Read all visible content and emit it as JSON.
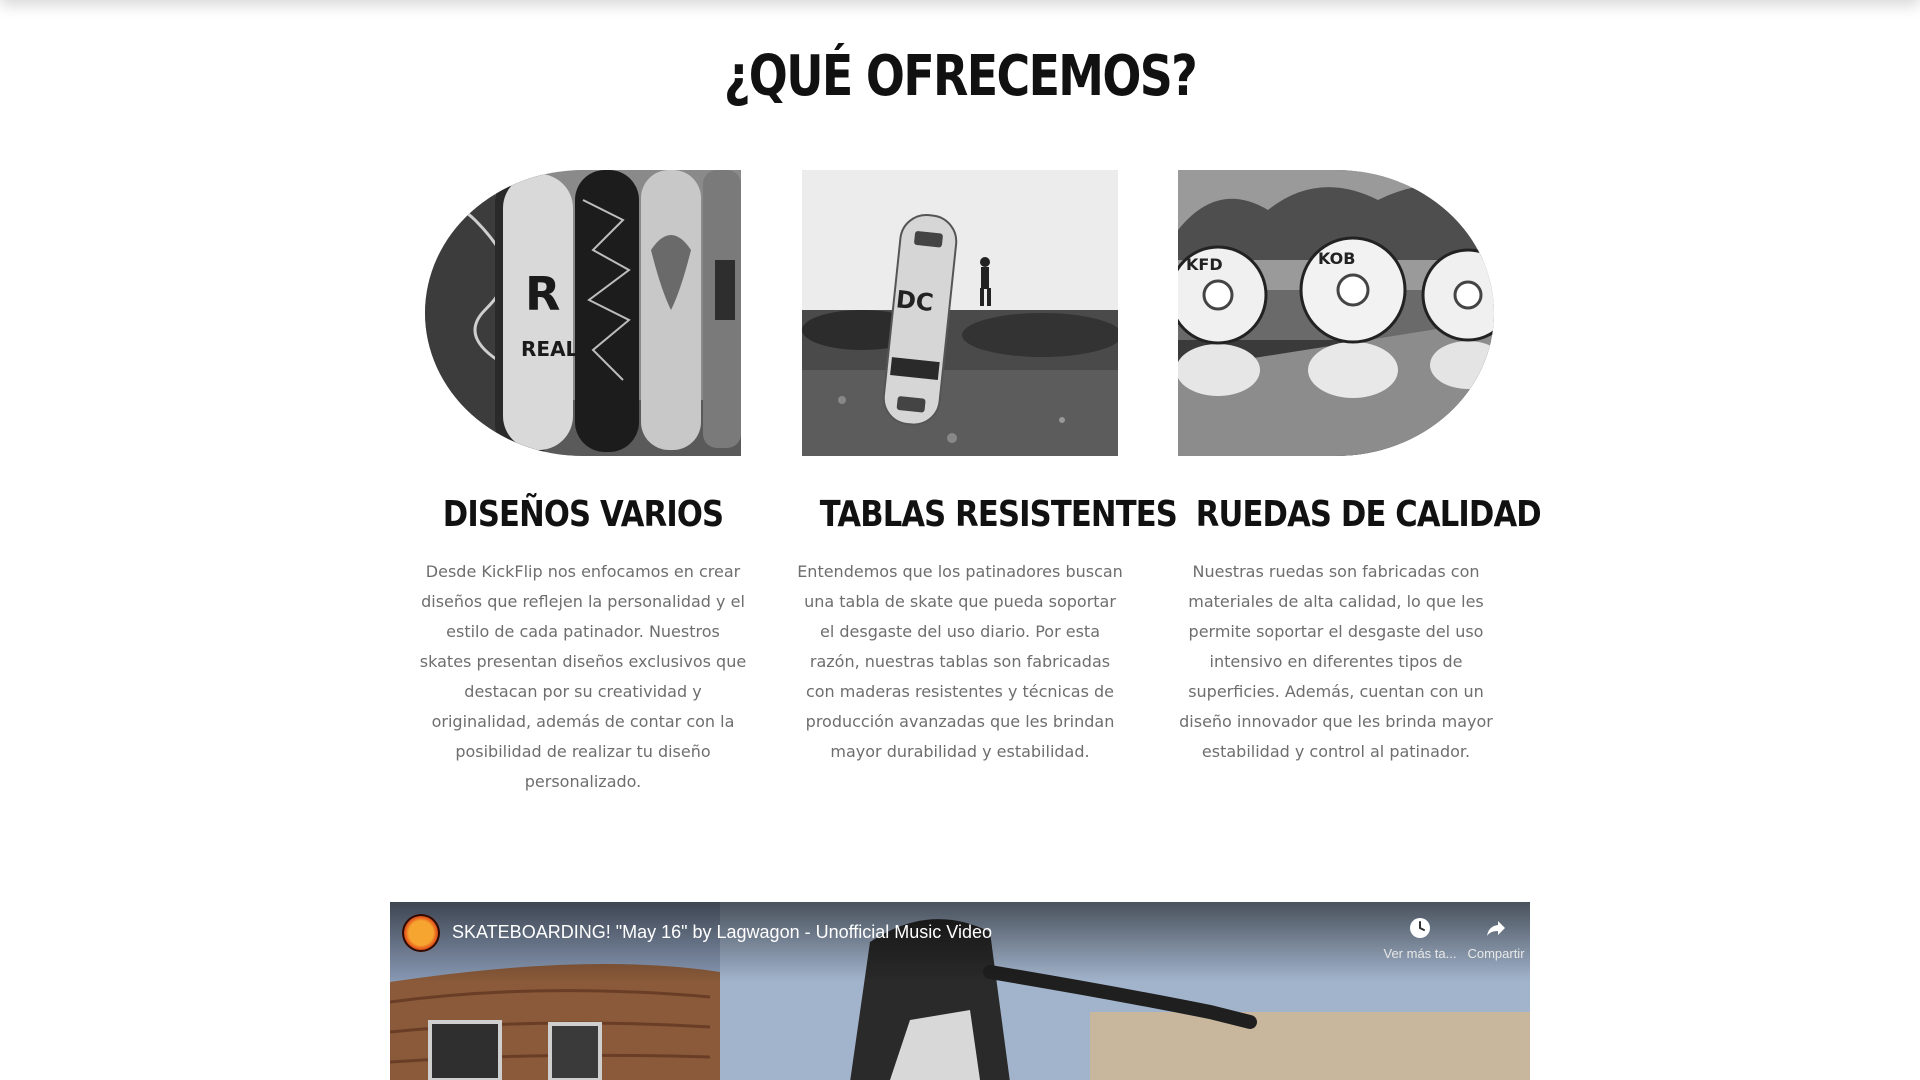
{
  "section": {
    "title": "¿QUÉ OFRECEMOS?"
  },
  "cards": [
    {
      "title": "DISEÑOS VARIOS",
      "text": "Desde KickFlip nos enfocamos en crear diseños que reflejen la personalidad y el estilo de cada patinador. Nuestros skates presentan diseños exclusivos que destacan por su creatividad y originalidad, además de contar con la posibilidad de realizar tu diseño personalizado.",
      "image_icon": "skateboard-decks-image"
    },
    {
      "title": "TABLAS RESISTENTES",
      "text": "Entendemos que los patinadores buscan una tabla de skate que pueda soportar el desgaste del uso diario. Por esta razón, nuestras tablas son fabricadas con maderas resistentes y técnicas de producción avanzadas que les brindan mayor durabilidad y estabilidad.",
      "image_icon": "skateboard-standing-image"
    },
    {
      "title": "RUEDAS DE CALIDAD",
      "text": "Nuestras ruedas son fabricadas con materiales de alta calidad, lo que les permite soportar el desgaste del uso intensivo en diferentes tipos de superficies. Además, cuentan con un diseño innovador que les brinda mayor estabilidad y control al patinador.",
      "image_icon": "skate-wheels-image"
    }
  ],
  "video": {
    "title": "SKATEBOARDING! \"May 16\" by Lagwagon - Unofficial Music Video",
    "watch_later_label": "Ver más ta...",
    "share_label": "Compartir",
    "channel_icon": "channel-avatar-icon",
    "watch_later_icon": "clock-icon",
    "share_icon": "share-arrow-icon"
  },
  "colors": {
    "heading": "#111111",
    "body_text": "#6e6e6e",
    "background": "#ffffff"
  }
}
